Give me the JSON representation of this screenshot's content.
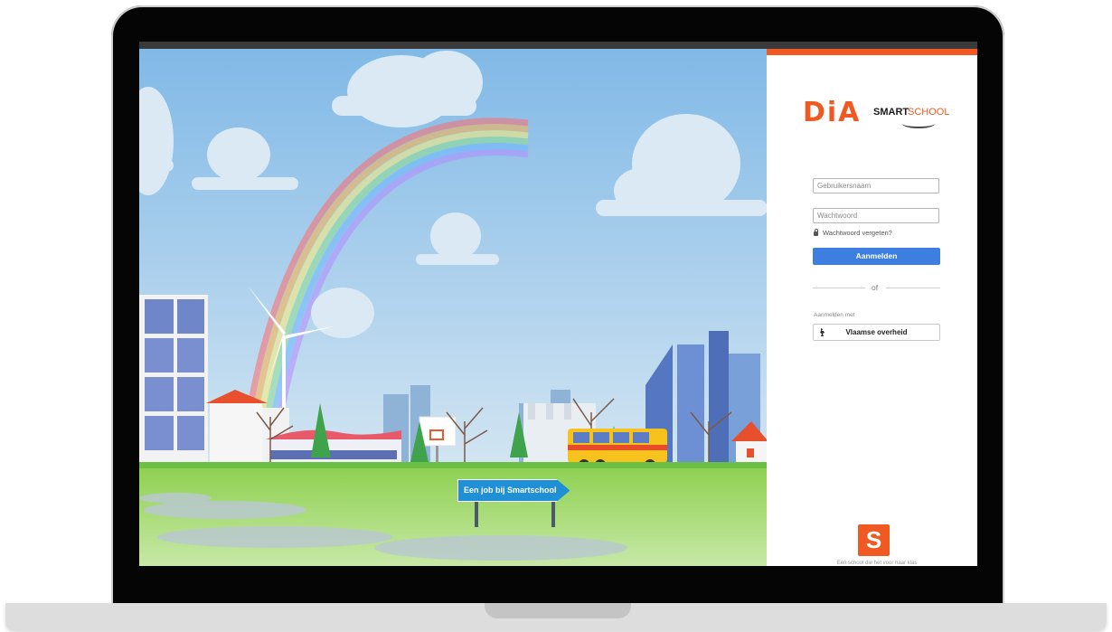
{
  "login": {
    "logo_text": "DiA",
    "logo_smart": "SMART",
    "logo_school": "SCHOOL",
    "username_placeholder": "Gebruikersnaam",
    "password_placeholder": "Wachtwoord",
    "forgot_label": "Wachtwoord vergeten?",
    "submit_label": "Aanmelden",
    "divider_label": "of",
    "login_with_label": "Aanmelden met",
    "gov_button_label": "Vlaamse overheid",
    "s_logo_letter": "S",
    "footer_label": "Een school die het voor haar klas"
  },
  "scene": {
    "job_sign_label": "Een job bij Smartschool"
  },
  "colors": {
    "accent": "#f05a22",
    "primary_button": "#3d7fe0",
    "sky": "#9cc6e8",
    "grass": "#7fc64a",
    "sign": "#1f8fd6"
  }
}
